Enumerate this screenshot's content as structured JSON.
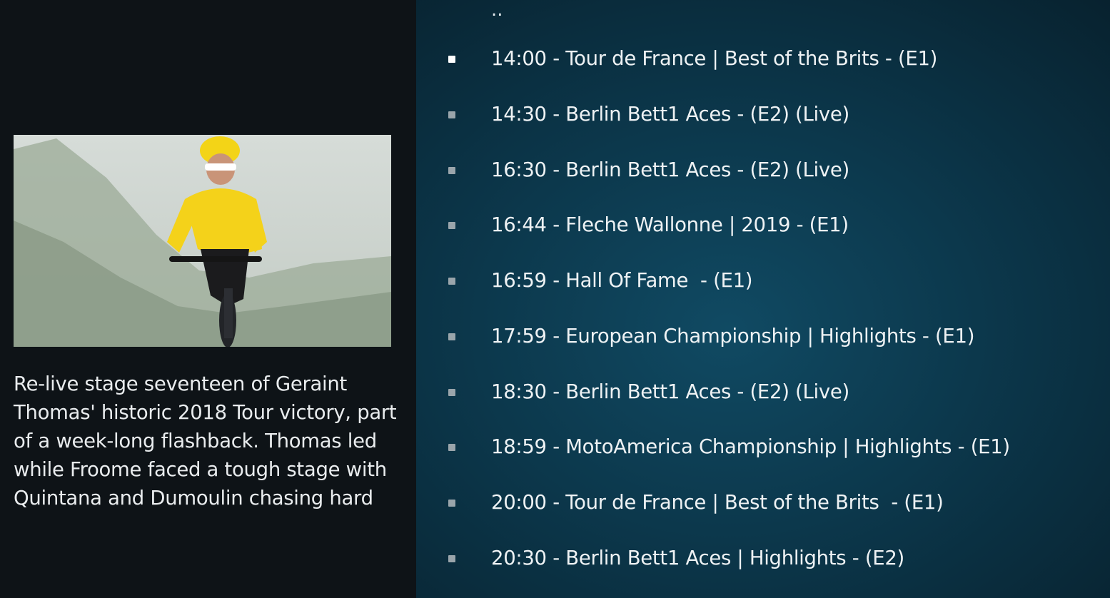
{
  "info": {
    "image": "cyclist-yellow-jersey",
    "plot": "Re-live stage seventeen of Geraint Thomas' historic 2018 Tour victory, part of a week-long flashback. Thomas led while Froome faced a tough stage with Quintana and Dumoulin chasing hard"
  },
  "list": {
    "parent_label": "..",
    "items": [
      {
        "label": "14:00 - Tour de France | Best of the Brits - (E1)"
      },
      {
        "label": "14:30 - Berlin Bett1 Aces - (E2) (Live)"
      },
      {
        "label": "16:30 - Berlin Bett1 Aces - (E2) (Live)"
      },
      {
        "label": "16:44 - Fleche Wallonne | 2019 - (E1)"
      },
      {
        "label": "16:59 - Hall Of Fame  - (E1)"
      },
      {
        "label": "17:59 - European Championship | Highlights - (E1)"
      },
      {
        "label": "18:30 - Berlin Bett1 Aces - (E2) (Live)"
      },
      {
        "label": "18:59 - MotoAmerica Championship | Highlights - (E1)"
      },
      {
        "label": "20:00 - Tour de France | Best of the Brits  - (E1)"
      },
      {
        "label": "20:30 - Berlin Bett1 Aces | Highlights - (E2)"
      }
    ]
  }
}
